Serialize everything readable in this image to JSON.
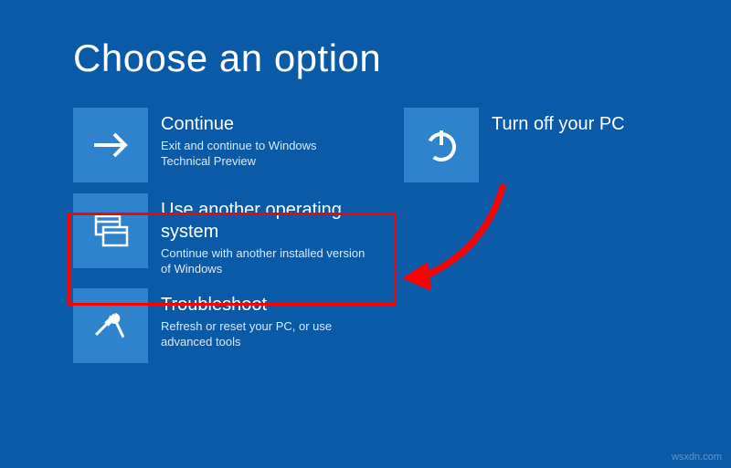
{
  "title": "Choose an option",
  "options": {
    "continue": {
      "label": "Continue",
      "desc": "Exit and continue to Windows Technical Preview"
    },
    "useAnother": {
      "label": "Use another operating system",
      "desc": "Continue with another installed version of Windows"
    },
    "troubleshoot": {
      "label": "Troubleshoot",
      "desc": "Refresh or reset your PC, or use advanced tools"
    },
    "turnOff": {
      "label": "Turn off your PC"
    }
  },
  "watermark": "wsxdn.com"
}
